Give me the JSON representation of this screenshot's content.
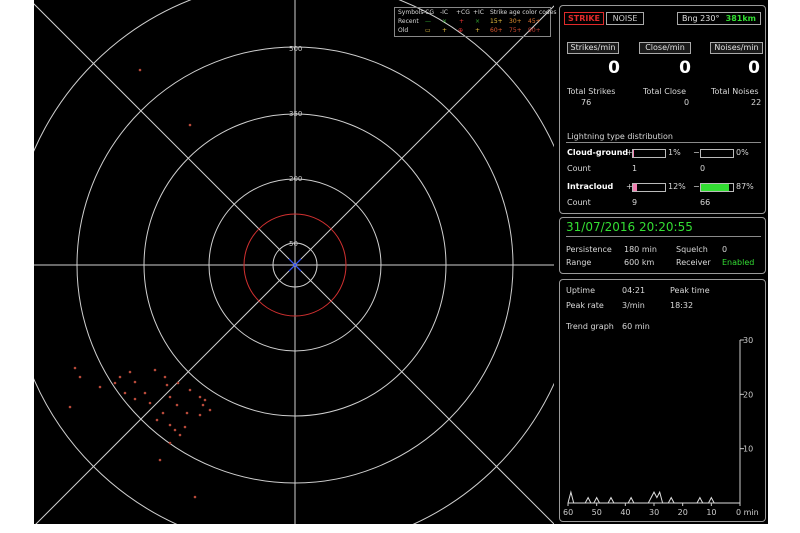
{
  "colors": {
    "accent_green": "#33dd33",
    "strike_red": "#e02a2a",
    "ring_red": "#d03030",
    "dot": "#b84a3a",
    "pink": "#f07fb0",
    "blue": "#3050ff"
  },
  "legend": {
    "header": {
      "symbols": "Symbols",
      "neg_cg": "-CG",
      "neg_ic": "-IC",
      "pos_cg": "+CG",
      "pos_ic": "+IC",
      "age": "Strike age color codes"
    },
    "recent": {
      "label": "Recent",
      "s1": "—",
      "s2": "×",
      "s3": "+",
      "s4": "×",
      "a1": "15+",
      "a2": "30+",
      "a3": "45+"
    },
    "old": {
      "label": "Old",
      "s1": "▭",
      "s2": "+",
      "s3": "⊕",
      "s4": "+",
      "a1": "60+",
      "a2": "75+",
      "a3": "90+"
    }
  },
  "radar": {
    "range_labels": [
      "500",
      "350",
      "200",
      "50"
    ],
    "strikes": [
      [
        -155,
        -195
      ],
      [
        -105,
        -140
      ],
      [
        -220,
        103
      ],
      [
        -215,
        112
      ],
      [
        -195,
        122
      ],
      [
        -165,
        107
      ],
      [
        -160,
        117
      ],
      [
        -140,
        105
      ],
      [
        -130,
        112
      ],
      [
        -128,
        120
      ],
      [
        -150,
        128
      ],
      [
        -145,
        138
      ],
      [
        -125,
        132
      ],
      [
        -117,
        118
      ],
      [
        -105,
        125
      ],
      [
        -95,
        132
      ],
      [
        -118,
        140
      ],
      [
        -108,
        148
      ],
      [
        -92,
        140
      ],
      [
        -85,
        145
      ],
      [
        -132,
        148
      ],
      [
        -138,
        155
      ],
      [
        -125,
        160
      ],
      [
        -110,
        162
      ],
      [
        -115,
        170
      ],
      [
        -125,
        178
      ],
      [
        -135,
        195
      ],
      [
        -95,
        150
      ],
      [
        -180,
        118
      ],
      [
        -170,
        128
      ],
      [
        -225,
        142
      ],
      [
        -100,
        232
      ],
      [
        -90,
        135
      ],
      [
        -160,
        134
      ],
      [
        -120,
        165
      ],
      [
        -175,
        112
      ]
    ]
  },
  "header": {
    "strike": "STRIKE",
    "noise": "NOISE",
    "bearing": "Bng 230°",
    "distance": "381km"
  },
  "rates": {
    "strikes_btn": "Strikes/min",
    "close_btn": "Close/min",
    "noises_btn": "Noises/min",
    "strikes_val": "0",
    "close_val": "0",
    "noises_val": "0",
    "total_strikes_label": "Total Strikes",
    "total_close_label": "Total Close",
    "total_noises_label": "Total Noises",
    "total_strikes": "76",
    "total_close": "0",
    "total_noises": "22"
  },
  "distribution": {
    "title": "Lightning type distribution",
    "cg_label": "Cloud-ground",
    "ic_label": "Intracloud",
    "count_label": "Count",
    "plus": "+",
    "minus": "−",
    "cg_pos_pct": "1%",
    "cg_neg_pct": "0%",
    "ic_pos_pct": "12%",
    "ic_neg_pct": "87%",
    "cg_pos_frac": 0.01,
    "cg_neg_frac": 0.0,
    "ic_pos_frac": 0.12,
    "ic_neg_frac": 0.87,
    "cg_count_pos": "1",
    "cg_count_neg": "0",
    "ic_count_pos": "9",
    "ic_count_neg": "66"
  },
  "status": {
    "datetime": "31/07/2016 20:20:55",
    "persistence_label": "Persistence",
    "persistence": "180 min",
    "squelch_label": "Squelch",
    "squelch": "0",
    "range_label": "Range",
    "range": "600 km",
    "receiver_label": "Receiver",
    "receiver": "Enabled"
  },
  "stats": {
    "uptime_label": "Uptime",
    "uptime": "04:21",
    "peaktime_label": "Peak time",
    "peakrate_label": "Peak rate",
    "peakrate": "3/min",
    "peaktime": "18:32",
    "trend_label": "Trend graph",
    "trend_range": "60 min"
  },
  "chart_data": {
    "type": "line",
    "x": [
      60,
      59,
      58,
      57,
      56,
      55,
      54,
      53,
      52,
      51,
      50,
      49,
      48,
      47,
      46,
      45,
      44,
      43,
      42,
      41,
      40,
      39,
      38,
      37,
      36,
      35,
      34,
      33,
      32,
      31,
      30,
      29,
      28,
      27,
      26,
      25,
      24,
      23,
      22,
      21,
      20,
      19,
      18,
      17,
      16,
      15,
      14,
      13,
      12,
      11,
      10,
      9,
      8,
      7,
      6,
      5,
      4,
      3,
      2,
      1,
      0
    ],
    "values": [
      0,
      2,
      0,
      0,
      0,
      0,
      0,
      1,
      0,
      0,
      1,
      0,
      0,
      0,
      0,
      1,
      0,
      0,
      0,
      0,
      0,
      0,
      1,
      0,
      0,
      0,
      0,
      0,
      0,
      1,
      2,
      1,
      2,
      0,
      0,
      0,
      1,
      0,
      0,
      0,
      0,
      0,
      0,
      0,
      0,
      0,
      1,
      0,
      0,
      0,
      1,
      0,
      0,
      0,
      0,
      0,
      0,
      0,
      0,
      0,
      0
    ],
    "x_ticks": [
      "60",
      "50",
      "40",
      "30",
      "20",
      "10",
      "0 min"
    ],
    "y_ticks": [
      "30",
      "20",
      "10"
    ],
    "xlim": [
      60,
      0
    ],
    "ylim": [
      0,
      30
    ]
  }
}
